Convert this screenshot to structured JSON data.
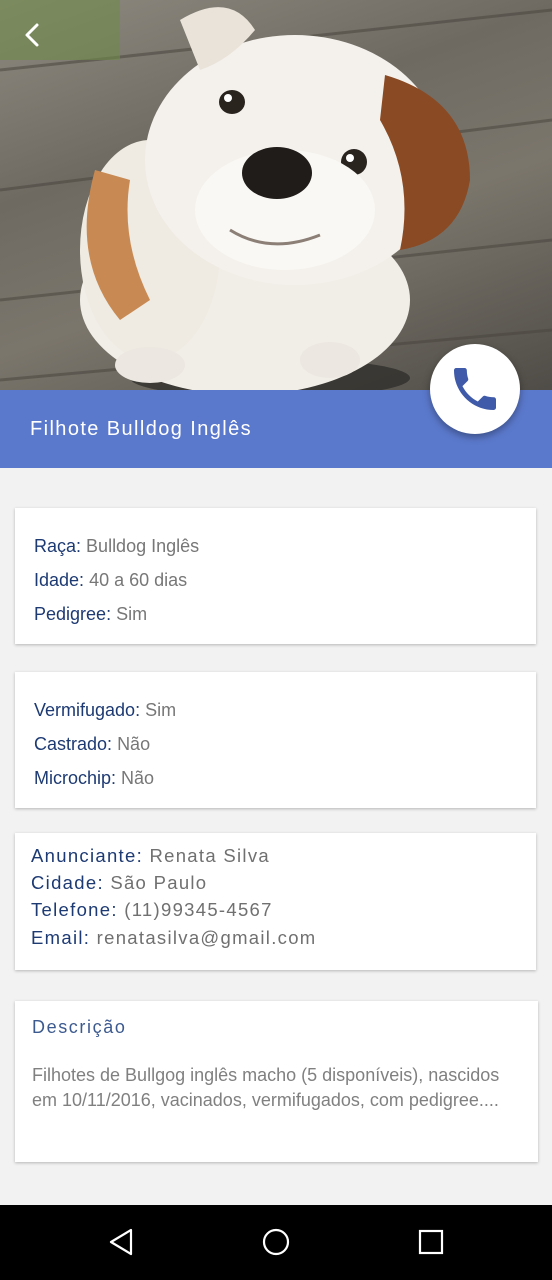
{
  "listing": {
    "title": "Filhote Bulldog Inglês"
  },
  "icons": {
    "back": "chevron-left-icon",
    "call": "phone-icon",
    "nav_back": "triangle-back-icon",
    "nav_home": "circle-home-icon",
    "nav_recents": "square-recents-icon"
  },
  "colors": {
    "accent": "#5b79cc",
    "label": "#1d3a73",
    "phone": "#3f5aa8"
  },
  "card1": {
    "raca_label": "Raça",
    "raca_value": "Bulldog Inglês",
    "idade_label": "Idade",
    "idade_value": "40 a 60 dias",
    "pedigree_label": "Pedigree",
    "pedigree_value": "Sim"
  },
  "card2": {
    "vermifugado_label": "Vermifugado",
    "vermifugado_value": "Sim",
    "castrado_label": "Castrado",
    "castrado_value": "Não",
    "microchip_label": "Microchip",
    "microchip_value": "Não"
  },
  "card3": {
    "anunciante_label": "Anunciante",
    "anunciante_value": "Renata Silva",
    "cidade_label": "Cidade",
    "cidade_value": "São Paulo",
    "telefone_label": "Telefone",
    "telefone_value": "(11)99345-4567",
    "email_label": "Email",
    "email_value": "renatasilva@gmail.com"
  },
  "description": {
    "heading": "Descrição",
    "text": "Filhotes de Bullgog inglês macho (5 disponíveis), nascidos em 10/11/2016, vacinados, vermifugados, com pedigree...."
  }
}
